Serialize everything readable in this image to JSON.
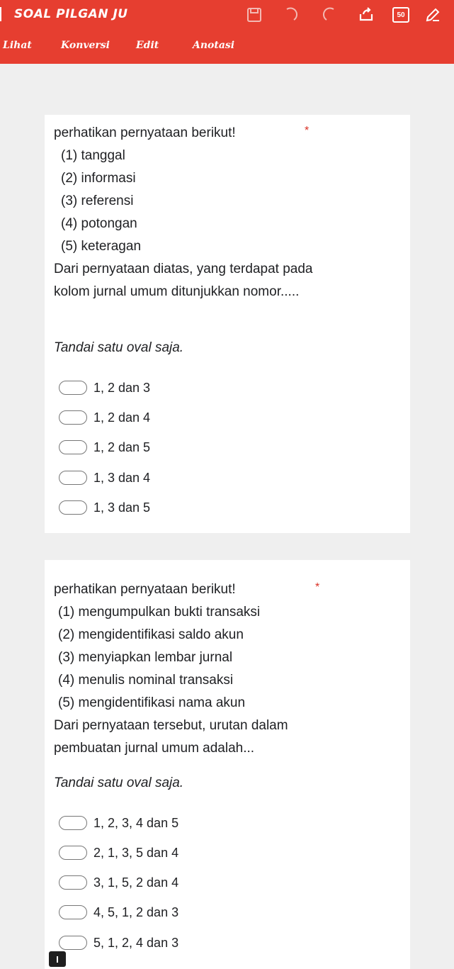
{
  "app": {
    "doc_title": "SOAL PILGAN JU",
    "page_count": "50"
  },
  "tabs": [
    {
      "label": "Lihat"
    },
    {
      "label": "Konversi"
    },
    {
      "label": "Edit"
    },
    {
      "label": "Anotasi"
    }
  ],
  "questions": [
    {
      "intro": "perhatikan pernyataan berikut!",
      "required_mark": "*",
      "statements": [
        "(1) tanggal",
        "(2) informasi",
        "(3) referensi",
        "(4) potongan",
        "(5) keteragan"
      ],
      "question": "Dari pernyataan diatas, yang terdapat pada kolom jurnal umum ditunjukkan nomor.....",
      "hint": "Tandai satu oval saja.",
      "options": [
        "1, 2 dan 3",
        "1, 2 dan 4",
        "1, 2 dan 5",
        "1, 3 dan 4",
        "1, 3 dan 5"
      ]
    },
    {
      "intro": "perhatikan pernyataan berikut!",
      "required_mark": "*",
      "statements": [
        "(1) mengumpulkan bukti transaksi",
        "(2) mengidentifikasi saldo akun",
        "(3) menyiapkan lembar jurnal",
        "(4) menulis nominal transaksi",
        "(5) mengidentifikasi nama akun"
      ],
      "question": "Dari pernyataan tersebut, urutan dalam pembuatan jurnal umum adalah...",
      "hint": "Tandai satu oval saja.",
      "options": [
        "1, 2, 3, 4 dan 5",
        "2, 1, 3, 5 dan 4",
        "3, 1, 5, 2 dan 4",
        "4, 5, 1, 2 dan 3",
        "5, 1, 2, 4 dan 3"
      ]
    }
  ],
  "icons": {
    "save": "save-icon",
    "undo": "undo-icon",
    "redo": "redo-icon",
    "share": "share-icon",
    "pen": "pen-icon"
  }
}
